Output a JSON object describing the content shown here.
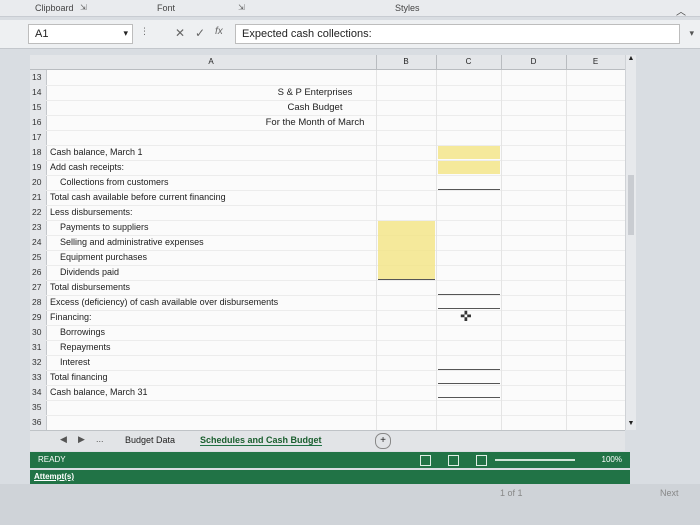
{
  "ribbon": {
    "clipboard": "Clipboard",
    "font": "Font",
    "styles": "Styles"
  },
  "formula_bar": {
    "name_box": "A1",
    "cancel": "✕",
    "enter": "✓",
    "fx": "fx",
    "value": "Expected cash collections:"
  },
  "columns": [
    "A",
    "B",
    "C",
    "D",
    "E"
  ],
  "rows": [
    {
      "num": "13",
      "text": ""
    },
    {
      "num": "14",
      "text": ""
    },
    {
      "num": "15",
      "text": ""
    },
    {
      "num": "16",
      "text": ""
    },
    {
      "num": "17",
      "text": ""
    },
    {
      "num": "18",
      "text": "Cash balance, March 1"
    },
    {
      "num": "19",
      "text": "Add cash receipts:"
    },
    {
      "num": "20",
      "text": "Collections from customers"
    },
    {
      "num": "21",
      "text": "Total cash available before current financing"
    },
    {
      "num": "22",
      "text": "Less disbursements:"
    },
    {
      "num": "23",
      "text": "Payments to suppliers"
    },
    {
      "num": "24",
      "text": "Selling and administrative expenses"
    },
    {
      "num": "25",
      "text": "Equipment purchases"
    },
    {
      "num": "26",
      "text": "Dividends paid"
    },
    {
      "num": "27",
      "text": "Total disbursements"
    },
    {
      "num": "28",
      "text": "Excess (deficiency) of cash available over disbursements"
    },
    {
      "num": "29",
      "text": "Financing:"
    },
    {
      "num": "30",
      "text": "Borrowings"
    },
    {
      "num": "31",
      "text": "Repayments"
    },
    {
      "num": "32",
      "text": "Interest"
    },
    {
      "num": "33",
      "text": "Total financing"
    },
    {
      "num": "34",
      "text": "Cash balance, March 31"
    },
    {
      "num": "35",
      "text": ""
    },
    {
      "num": "36",
      "text": ""
    }
  ],
  "heading": {
    "line1": "S & P Enterprises",
    "line2": "Cash Budget",
    "line3": "For the Month of March"
  },
  "tabs": {
    "prev": "◀",
    "next": "▶",
    "ellipsis": "...",
    "sheet1": "Budget Data",
    "sheet2": "Schedules and Cash Budget",
    "add": "+"
  },
  "status": {
    "ready": "READY",
    "zoom": "100%"
  },
  "footer": {
    "attempts": "Attempt(s)",
    "page": "1 of 1",
    "next": "Next"
  }
}
